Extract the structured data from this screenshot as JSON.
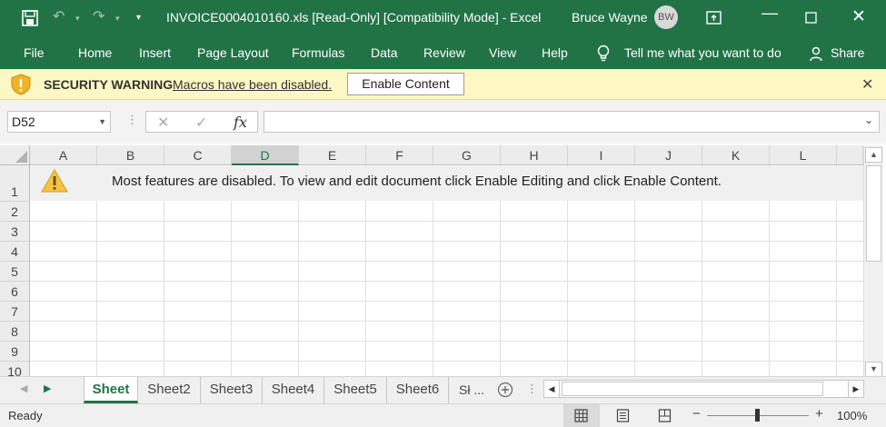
{
  "window": {
    "title": "INVOICE0004010160.xls  [Read-Only]  [Compatibility Mode]  -  Excel",
    "user": "Bruce Wayne",
    "avatar_initials": "BW"
  },
  "ribbon": {
    "tabs": [
      "File",
      "Home",
      "Insert",
      "Page Layout",
      "Formulas",
      "Data",
      "Review",
      "View",
      "Help"
    ],
    "tell_me": "Tell me what you want to do",
    "share": "Share"
  },
  "security": {
    "title": "SECURITY WARNING",
    "message": "Macros have been disabled.",
    "button": "Enable Content",
    "close": "✕"
  },
  "formula_bar": {
    "name_box": "D52",
    "cancel": "✕",
    "enter": "✓",
    "fx": "fx",
    "value": ""
  },
  "grid": {
    "columns": [
      "A",
      "B",
      "C",
      "D",
      "E",
      "F",
      "G",
      "H",
      "I",
      "J",
      "K",
      "L"
    ],
    "selected_column": "D",
    "rows": [
      "1",
      "2",
      "3",
      "4",
      "5",
      "6",
      "7",
      "8",
      "9",
      "10"
    ],
    "banner": "Most features are disabled. To view and edit document click Enable Editing and click Enable Content."
  },
  "sheets": {
    "tabs": [
      "Sheet",
      "Sheet2",
      "Sheet3",
      "Sheet4",
      "Sheet5",
      "Sheet6",
      "Sł ..."
    ],
    "active": "Sheet"
  },
  "status": {
    "text": "Ready",
    "zoom": "100%",
    "zoom_level": 1.0
  },
  "colors": {
    "accent": "#217346",
    "warning_bg": "#fdf7c3"
  }
}
